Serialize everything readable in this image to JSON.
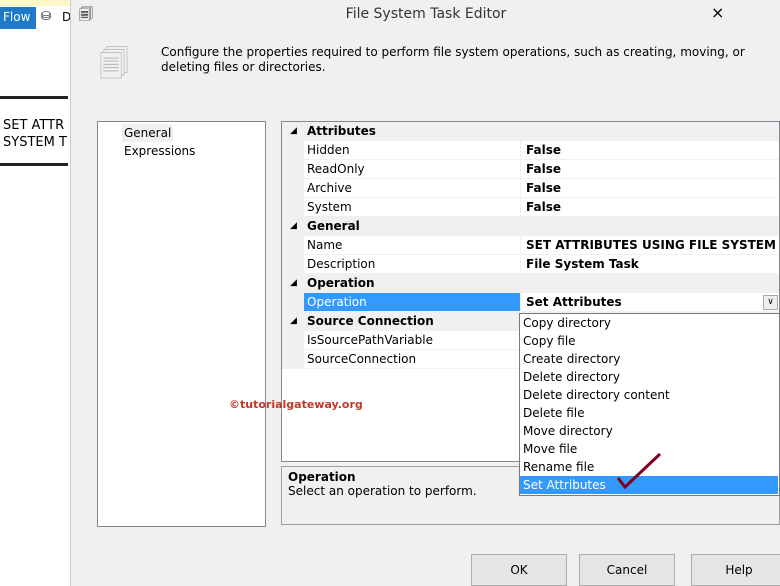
{
  "background": {
    "tab": "Flow",
    "tab_partial": "D",
    "task_label": "SET ATTR\nSYSTEM T"
  },
  "window": {
    "title": "File System Task Editor",
    "close": "×",
    "description": "Configure the properties required to perform file system operations, such as creating, moving, or deleting files or directories."
  },
  "nav": [
    {
      "label": "General"
    },
    {
      "label": "Expressions"
    }
  ],
  "grid": [
    {
      "type": "cat",
      "label": "Attributes"
    },
    {
      "type": "prop",
      "name": "Hidden",
      "value": "False"
    },
    {
      "type": "prop",
      "name": "ReadOnly",
      "value": "False"
    },
    {
      "type": "prop",
      "name": "Archive",
      "value": "False"
    },
    {
      "type": "prop",
      "name": "System",
      "value": "False"
    },
    {
      "type": "cat",
      "label": "General"
    },
    {
      "type": "prop",
      "name": "Name",
      "value": "SET ATTRIBUTES USING FILE SYSTEM TASK IN"
    },
    {
      "type": "prop",
      "name": "Description",
      "value": "File System Task"
    },
    {
      "type": "cat",
      "label": "Operation"
    },
    {
      "type": "prop",
      "name": "Operation",
      "value": "Set Attributes",
      "selected": true
    },
    {
      "type": "cat",
      "label": "Source Connection"
    },
    {
      "type": "prop",
      "name": "IsSourcePathVariable",
      "value": ""
    },
    {
      "type": "prop",
      "name": "SourceConnection",
      "value": ""
    }
  ],
  "dropdown": [
    "Copy directory",
    "Copy file",
    "Create directory",
    "Delete directory",
    "Delete directory content",
    "Delete file",
    "Move directory",
    "Move file",
    "Rename file",
    "Set Attributes"
  ],
  "dropdown_selected": 9,
  "watermark": "©tutorialgateway.org",
  "help_panel": {
    "title": "Operation",
    "text": "Select an operation to perform."
  },
  "buttons": {
    "ok": "OK",
    "cancel": "Cancel",
    "help": "Help"
  }
}
